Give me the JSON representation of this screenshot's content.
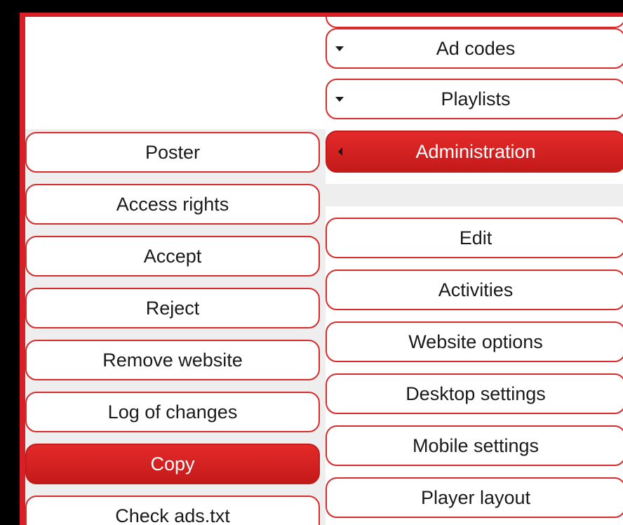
{
  "top_menu": {
    "ad_codes_label": "Ad codes",
    "playlists_label": "Playlists",
    "administration_label": "Administration"
  },
  "left_menu": {
    "items": [
      {
        "label": "Poster"
      },
      {
        "label": "Access rights"
      },
      {
        "label": "Accept"
      },
      {
        "label": "Reject"
      },
      {
        "label": "Remove website"
      },
      {
        "label": "Log of changes"
      },
      {
        "label": "Copy"
      },
      {
        "label": "Check ads.txt"
      }
    ]
  },
  "right_menu": {
    "items": [
      {
        "label": "Edit"
      },
      {
        "label": "Activities"
      },
      {
        "label": "Website options"
      },
      {
        "label": "Desktop settings"
      },
      {
        "label": "Mobile settings"
      },
      {
        "label": "Player layout"
      }
    ]
  },
  "colors": {
    "accent": "#d81f26",
    "background": "#000000",
    "panel": "#ffffff",
    "submenu_bg": "#eeeeee"
  }
}
